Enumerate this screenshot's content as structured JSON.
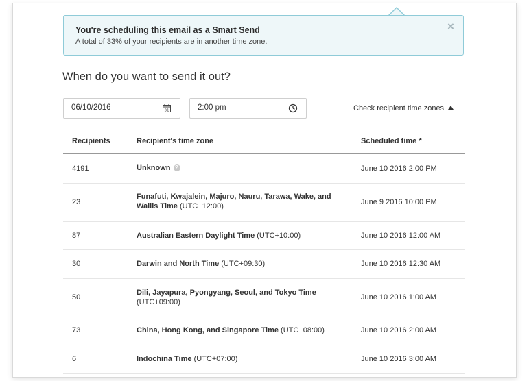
{
  "alert": {
    "title": "You're scheduling this email as a Smart Send",
    "body": "A total of 33% of your recipients are in another time zone.",
    "close_icon": "close-icon"
  },
  "heading": "When do you want to send it out?",
  "date_input": {
    "value": "06/10/2016",
    "icon": "calendar-icon"
  },
  "time_input": {
    "value": "2:00 pm",
    "icon": "clock-icon"
  },
  "check_tz": {
    "label": "Check recipient time zones",
    "icon": "caret-up-icon"
  },
  "table": {
    "headers": {
      "recipients": "Recipients",
      "timezone": "Recipient's time zone",
      "scheduled": "Scheduled time *"
    },
    "rows": [
      {
        "count": "4191",
        "tz": "Unknown",
        "offset": "",
        "help": true,
        "scheduled": "June 10 2016 2:00 PM"
      },
      {
        "count": "23",
        "tz": "Funafuti, Kwajalein, Majuro, Nauru, Tarawa, Wake, and Wallis Time",
        "offset": "(UTC+12:00)",
        "scheduled": "June 9 2016 10:00 PM"
      },
      {
        "count": "87",
        "tz": "Australian Eastern Daylight Time",
        "offset": "(UTC+10:00)",
        "scheduled": "June 10 2016 12:00 AM"
      },
      {
        "count": "30",
        "tz": "Darwin and North Time",
        "offset": "(UTC+09:30)",
        "scheduled": "June 10 2016 12:30 AM"
      },
      {
        "count": "50",
        "tz": "Dili, Jayapura, Pyongyang, Seoul, and Tokyo Time",
        "offset": "(UTC+09:00)",
        "scheduled": "June 10 2016 1:00 AM"
      },
      {
        "count": "73",
        "tz": "China, Hong Kong, and Singapore Time",
        "offset": "(UTC+08:00)",
        "scheduled": "June 10 2016 2:00 AM"
      },
      {
        "count": "6",
        "tz": "Indochina Time",
        "offset": "(UTC+07:00)",
        "scheduled": "June 10 2016 3:00 AM"
      }
    ]
  },
  "colors": {
    "alert_bg": "#eef7f9",
    "alert_border": "#8fcbd8"
  }
}
